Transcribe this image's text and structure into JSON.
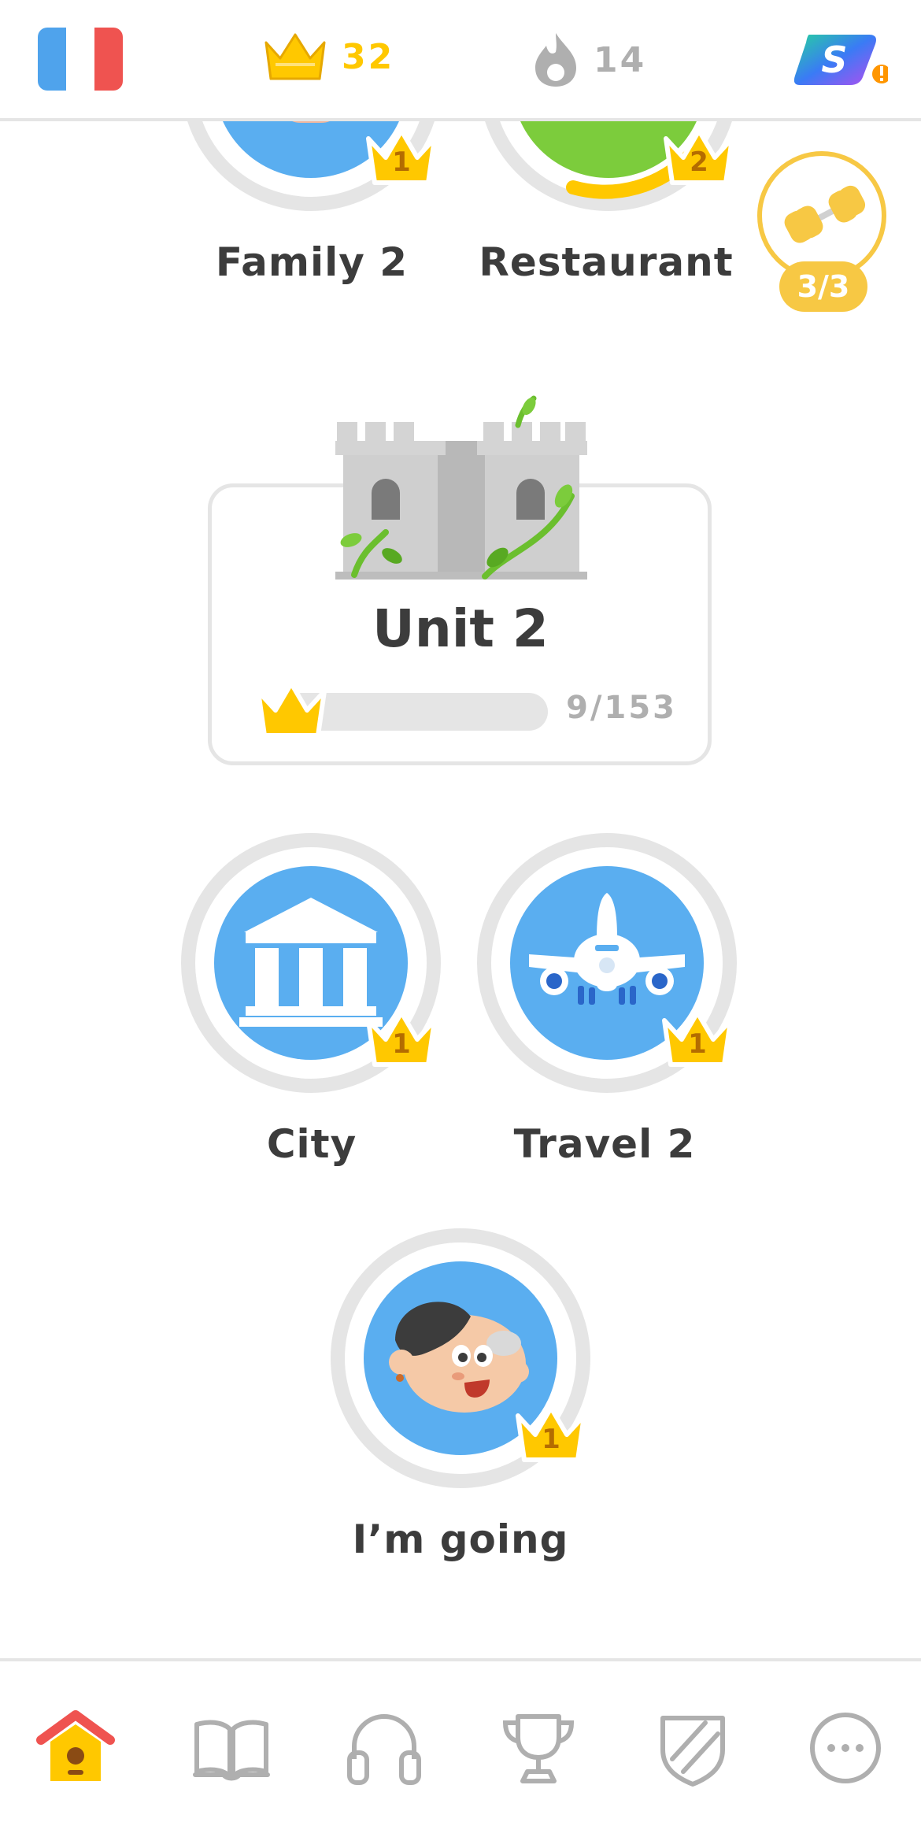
{
  "header": {
    "language_flag": "france-flag-icon",
    "crowns_count": "32",
    "streak_count": "14",
    "super_badge": "super-icon"
  },
  "skills": {
    "family2": {
      "label": "Family 2",
      "crown_level": "1"
    },
    "restaurant": {
      "label": "Restaurant",
      "crown_level": "2"
    },
    "city": {
      "label": "City",
      "crown_level": "1"
    },
    "travel2": {
      "label": "Travel 2",
      "crown_level": "1"
    },
    "im_going": {
      "label": "I’m going",
      "crown_level": "1"
    }
  },
  "practice": {
    "label": "3/3"
  },
  "unit": {
    "title": "Unit 2",
    "progress_text": "9/153",
    "progress_fraction": 0.0588
  },
  "nav": {
    "items": [
      "home-icon",
      "stories-icon",
      "listening-icon",
      "leaderboards-icon",
      "shop-icon",
      "more-icon"
    ]
  },
  "colors": {
    "accent_gold": "#ffc800",
    "crown_text": "#b46c00",
    "skill_blue": "#5aaef0",
    "ring_gray": "#e5e5e5",
    "restaurant_green": "#7ccc3c",
    "practice_yellow": "#f7c844"
  }
}
